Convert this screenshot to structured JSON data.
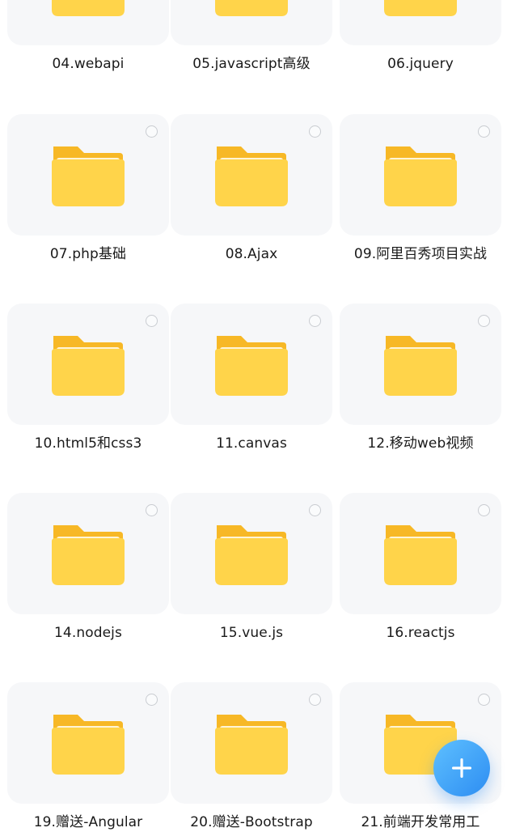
{
  "folders": [
    {
      "name": "04.webapi"
    },
    {
      "name": "05.javascript高级"
    },
    {
      "name": "06.jquery"
    },
    {
      "name": "07.php基础"
    },
    {
      "name": "08.Ajax"
    },
    {
      "name": "09.阿里百秀项目实战"
    },
    {
      "name": "10.html5和css3"
    },
    {
      "name": "11.canvas"
    },
    {
      "name": "12.移动web视频"
    },
    {
      "name": "14.nodejs"
    },
    {
      "name": "15.vue.js"
    },
    {
      "name": "16.reactjs"
    },
    {
      "name": "19.赠送-Angular"
    },
    {
      "name": "20.赠送-Bootstrap"
    },
    {
      "name": "21.前端开发常用工"
    }
  ],
  "colors": {
    "folder_body": "#ffd44a",
    "folder_tab": "#f7b826",
    "fab": "#2d8df2"
  },
  "icons": {
    "folder": "folder-icon",
    "selection": "selection-circle-icon",
    "fab": "plus-icon"
  }
}
